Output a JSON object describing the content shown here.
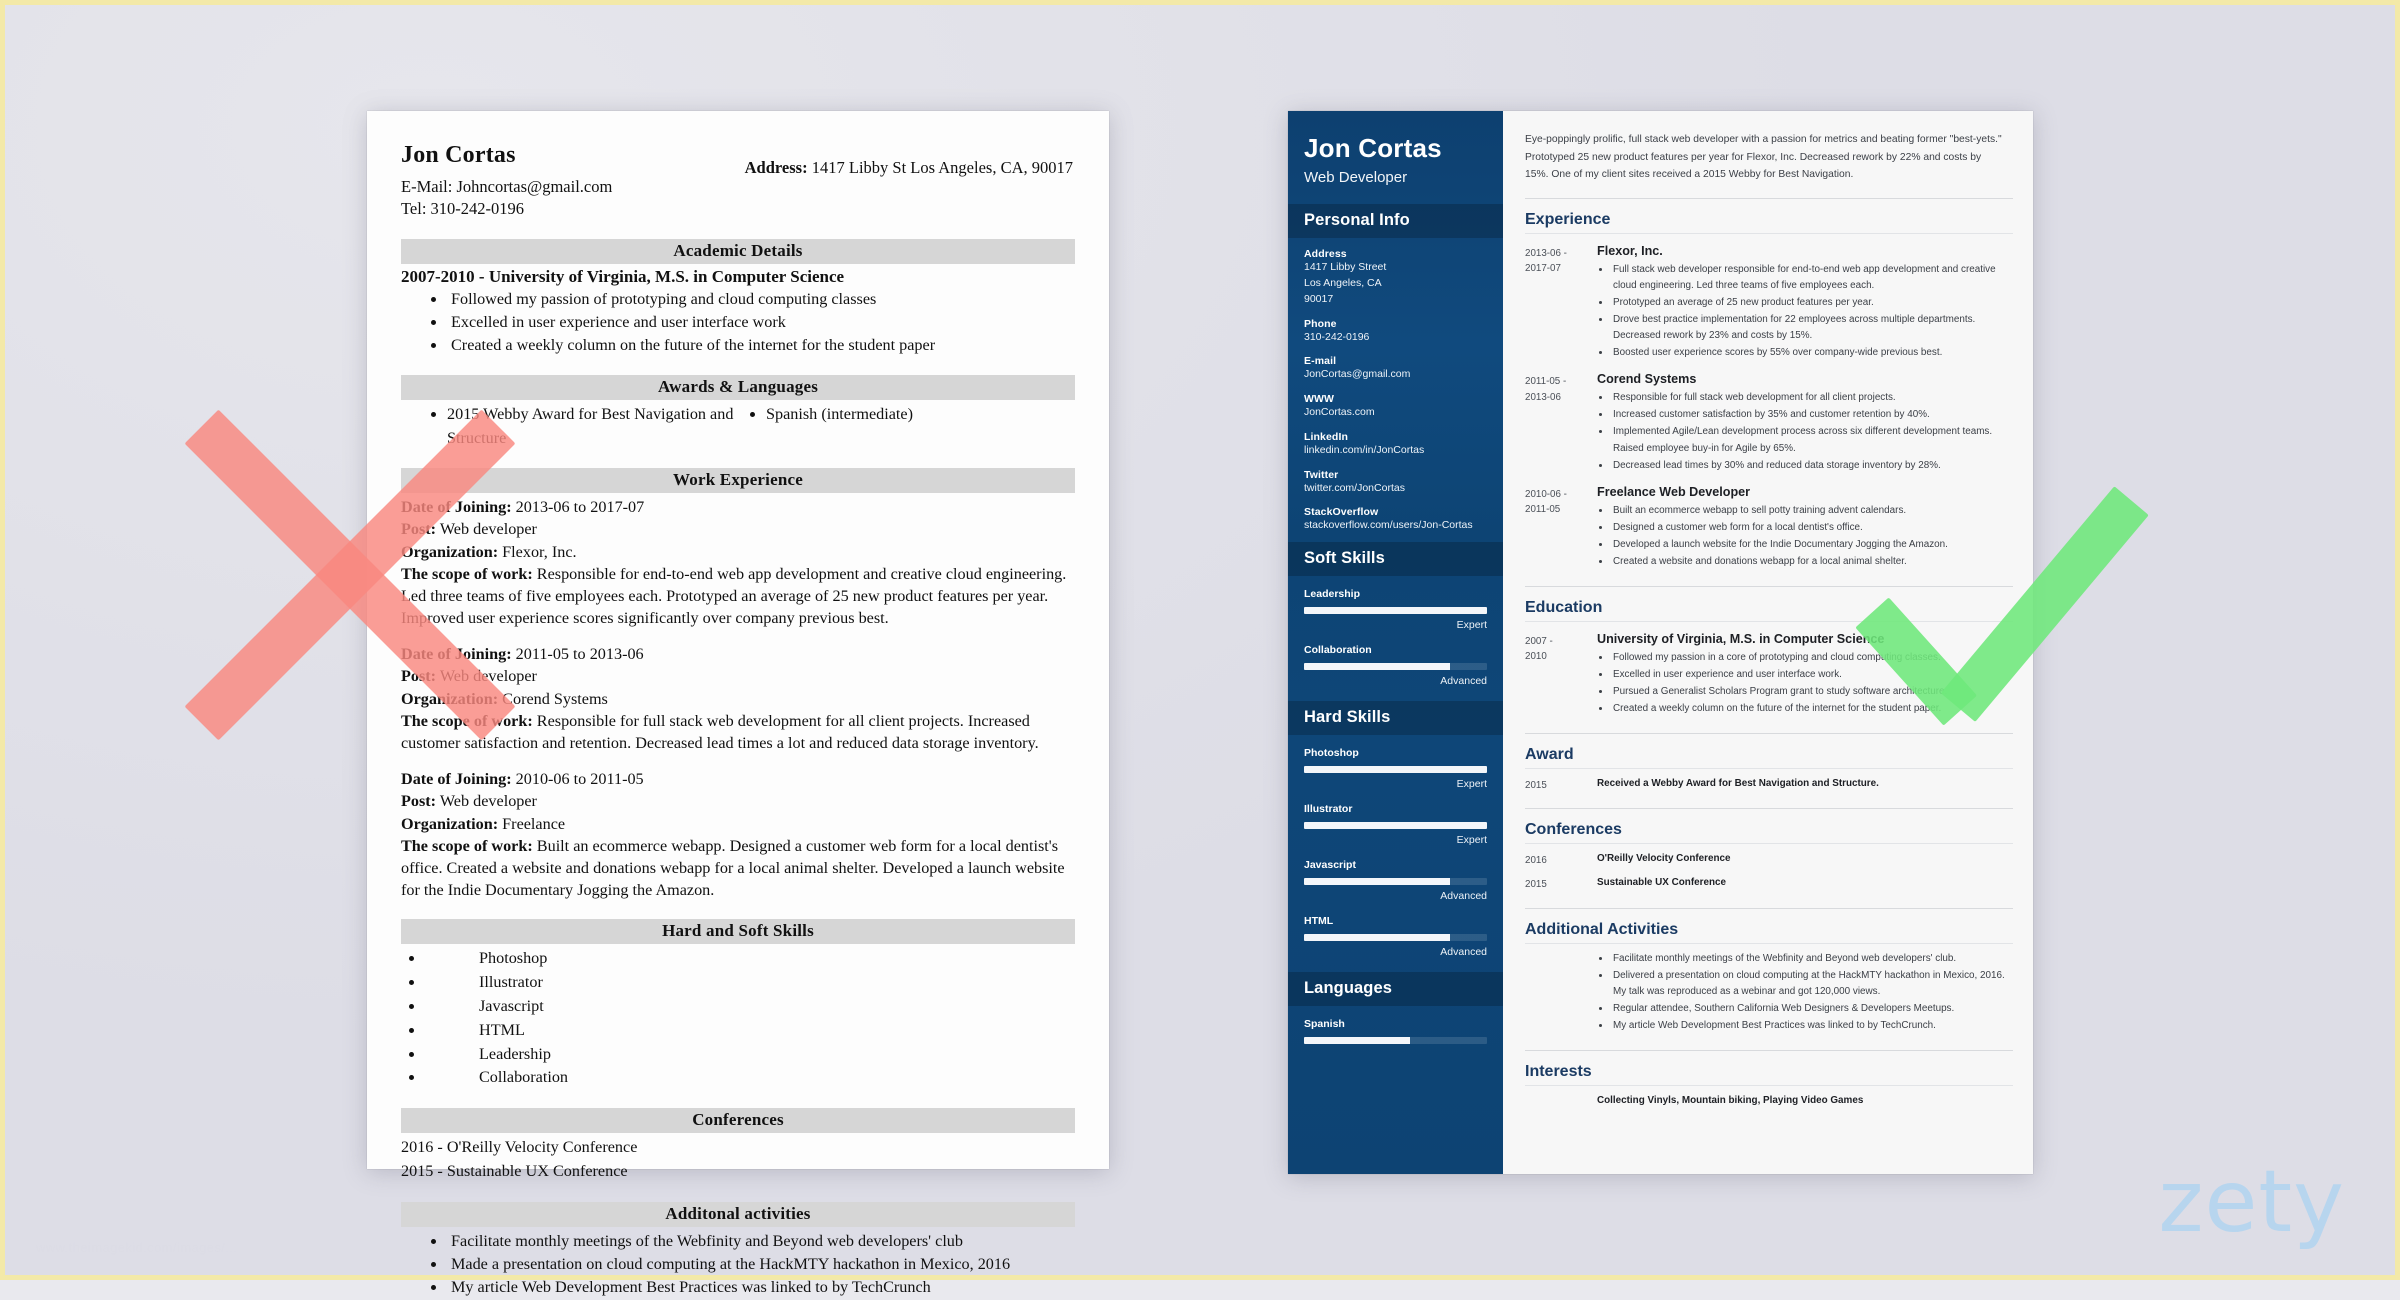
{
  "watermarks": {
    "brand": "zety",
    "source": "www.theimagekid.com/images/..."
  },
  "left_resume": {
    "name": "Jon Cortas",
    "email_line": "E-Mail: Johncortas@gmail.com",
    "tel_line": "Tel: 310-242-0196",
    "address_label": "Address:",
    "address_value": "1417 Libby St Los Angeles, CA, 90017",
    "sections": {
      "academic": {
        "title": "Academic Details",
        "degree": "2007-2010 - University of Virginia, M.S. in Computer Science",
        "bullets": [
          "Followed my passion of prototyping and cloud computing classes",
          "Excelled in user experience and user interface work",
          "Created a weekly column on the future of the internet for the student paper"
        ]
      },
      "awards": {
        "title": "Awards & Languages",
        "award": "2015 Webby Award for Best Navigation and Structure",
        "language": "Spanish (intermediate)"
      },
      "work": {
        "title": "Work Experience",
        "labels": {
          "date": "Date of Joining:",
          "post": "Post:",
          "org": "Organization:",
          "scope": "The scope of work:"
        },
        "jobs": [
          {
            "date": "2013-06 to 2017-07",
            "post": "Web developer",
            "org": "Flexor, Inc.",
            "scope": "Responsible for end-to-end web app development and creative cloud engineering. Led three teams of five employees each. Prototyped an average of 25 new product features per year. Improved user experience scores significantly over company previous best."
          },
          {
            "date": "2011-05 to 2013-06",
            "post": "Web developer",
            "org": "Corend Systems",
            "scope": "Responsible for full stack web development for all client projects. Increased customer satisfaction and retention. Decreased lead times a lot and reduced data storage inventory."
          },
          {
            "date": "2010-06 to 2011-05",
            "post": "Web developer",
            "org": "Freelance",
            "scope": "Built an ecommerce webapp. Designed a customer web form for a local dentist's office. Created a website and donations webapp for a local animal shelter. Developed a launch website for the Indie Documentary Jogging the Amazon."
          }
        ]
      },
      "skills": {
        "title": "Hard and Soft Skills",
        "items": [
          "Photoshop",
          "Illustrator",
          "Javascript",
          "HTML",
          "Leadership",
          "Collaboration"
        ]
      },
      "conferences": {
        "title": "Conferences",
        "items": [
          "2016 - O'Reilly Velocity Conference",
          "2015 - Sustainable UX Conference"
        ]
      },
      "additional": {
        "title": "Additonal activities",
        "items": [
          "Facilitate monthly meetings of the Webfinity and Beyond web developers' club",
          "Made a presentation on cloud computing at the HackMTY hackathon in Mexico, 2016",
          "My article Web Development Best Practices was linked to by TechCrunch"
        ]
      }
    }
  },
  "right_resume": {
    "accent_color": "#1b3b63",
    "sidebar_color": "#0e4678",
    "header": {
      "name": "Jon Cortas",
      "title": "Web Developer"
    },
    "personal_info": {
      "section_title": "Personal Info",
      "fields": [
        {
          "label": "Address",
          "value": "1417 Libby Street\nLos Angeles, CA\n90017"
        },
        {
          "label": "Phone",
          "value": "310-242-0196"
        },
        {
          "label": "E-mail",
          "value": "JonCortas@gmail.com"
        },
        {
          "label": "WWW",
          "value": "JonCortas.com"
        },
        {
          "label": "LinkedIn",
          "value": "linkedin.com/in/JonCortas"
        },
        {
          "label": "Twitter",
          "value": "twitter.com/JonCortas"
        },
        {
          "label": "StackOverflow",
          "value": "stackoverflow.com/users/Jon-Cortas"
        }
      ]
    },
    "soft_skills": {
      "section_title": "Soft Skills",
      "items": [
        {
          "name": "Leadership",
          "level": "Expert",
          "percent": 100
        },
        {
          "name": "Collaboration",
          "level": "Advanced",
          "percent": 80
        }
      ]
    },
    "hard_skills": {
      "section_title": "Hard Skills",
      "items": [
        {
          "name": "Photoshop",
          "level": "Expert",
          "percent": 100
        },
        {
          "name": "Illustrator",
          "level": "Expert",
          "percent": 100
        },
        {
          "name": "Javascript",
          "level": "Advanced",
          "percent": 80
        },
        {
          "name": "HTML",
          "level": "Advanced",
          "percent": 80
        }
      ]
    },
    "languages": {
      "section_title": "Languages",
      "items": [
        {
          "name": "Spanish",
          "level": "",
          "percent": 58
        }
      ]
    },
    "summary": "Eye-poppingly prolific, full stack web developer with a passion for metrics and beating former \"best-yets.\" Prototyped 25 new product features per year for Flexor, Inc. Decreased rework by 22% and costs by 15%. One of my client sites received a 2015 Webby for Best Navigation.",
    "experience": {
      "heading": "Experience",
      "entries": [
        {
          "date": "2013-06 -\n2017-07",
          "org": "Flexor, Inc.",
          "bullets": [
            "Full stack web developer responsible for end-to-end web app development and creative cloud engineering. Led three teams of five employees each.",
            "Prototyped an average of 25 new product features per year.",
            "Drove best practice implementation for 22 employees across multiple departments. Decreased rework by 23% and costs by 15%.",
            "Boosted user experience scores by 55% over company-wide previous best."
          ]
        },
        {
          "date": "2011-05 -\n2013-06",
          "org": "Corend Systems",
          "bullets": [
            "Responsible for full stack web development for all client projects.",
            "Increased customer satisfaction by 35% and customer retention by 40%.",
            "Implemented Agile/Lean development process across six different development teams. Raised employee buy-in for Agile by 65%.",
            "Decreased lead times by 30% and reduced data storage inventory by 28%."
          ]
        },
        {
          "date": "2010-06 -\n2011-05",
          "org": "Freelance Web Developer",
          "bullets": [
            "Built an ecommerce webapp to sell potty training advent calendars.",
            "Designed a customer web form for a local dentist's office.",
            "Developed a launch website for the Indie Documentary Jogging the Amazon.",
            "Created a website and donations webapp for a local animal shelter."
          ]
        }
      ]
    },
    "education": {
      "heading": "Education",
      "entries": [
        {
          "date": "2007 -\n2010",
          "org": "University of Virginia, M.S. in Computer Science",
          "bullets": [
            "Followed my passion in a core of prototyping and cloud computing classes.",
            "Excelled in user experience and user interface work.",
            "Pursued a Generalist Scholars Program grant to study software architecture.",
            "Created a weekly column on the future of the internet for the student paper."
          ]
        }
      ]
    },
    "award": {
      "heading": "Award",
      "entries": [
        {
          "date": "2015",
          "text": "Received a Webby Award for Best Navigation and Structure."
        }
      ]
    },
    "conferences": {
      "heading": "Conferences",
      "entries": [
        {
          "date": "2016",
          "text": "O'Reilly Velocity Conference"
        },
        {
          "date": "2015",
          "text": "Sustainable UX Conference"
        }
      ]
    },
    "additional_activities": {
      "heading": "Additional Activities",
      "bullets": [
        "Facilitate monthly meetings of the Webfinity and Beyond web developers' club.",
        "Delivered a presentation on cloud computing at the HackMTY hackathon in Mexico, 2016. My talk was reproduced as a webinar and got 120,000 views.",
        "Regular attendee, Southern California Web Designers & Developers Meetups.",
        "My article Web Development Best Practices was linked to by TechCrunch."
      ]
    },
    "interests": {
      "heading": "Interests",
      "text": "Collecting Vinyls, Mountain biking, Playing Video Games"
    }
  },
  "annotations": {
    "reject_mark": "red-x",
    "approve_mark": "green-check"
  }
}
